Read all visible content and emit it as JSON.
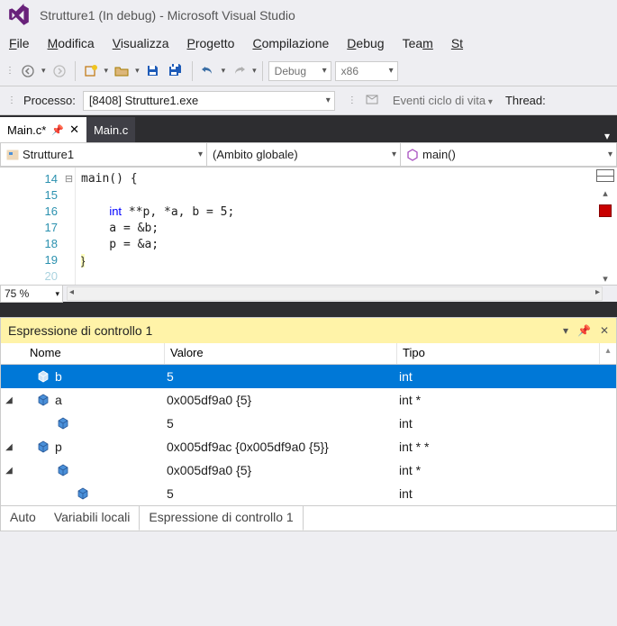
{
  "title": "Strutture1 (In debug) - Microsoft Visual Studio",
  "menu": {
    "file": "File",
    "modifica": "Modifica",
    "visualizza": "Visualizza",
    "progetto": "Progetto",
    "compilazione": "Compilazione",
    "debug": "Debug",
    "team": "Team",
    "strumenti": "St"
  },
  "toolbar": {
    "config": "Debug",
    "platform": "x86"
  },
  "process": {
    "label": "Processo:",
    "value": "[8408] Strutture1.exe",
    "lifecycle": "Eventi ciclo di vita",
    "thread": "Thread:"
  },
  "tabs": {
    "active": "Main.c*",
    "inactive": "Main.c"
  },
  "nav": {
    "project": "Strutture1",
    "scope": "(Ambito globale)",
    "func": "main()"
  },
  "editor": {
    "lines": [
      "14",
      "15",
      "16",
      "17",
      "18",
      "19",
      "20"
    ],
    "code_lines": [
      {
        "text": "main() {",
        "indent": 0
      },
      {
        "text": "",
        "indent": 0
      },
      {
        "text": "int **p, *a, b = 5;",
        "indent": 1,
        "kw": "int"
      },
      {
        "text": "a = &b;",
        "indent": 1
      },
      {
        "text": "p = &a;",
        "indent": 1
      },
      {
        "text": "}",
        "indent": 0
      },
      {
        "text": "",
        "indent": 0
      }
    ],
    "zoom": "75 %"
  },
  "watch": {
    "title": "Espressione di controllo 1",
    "headers": {
      "name": "Nome",
      "value": "Valore",
      "type": "Tipo"
    },
    "rows": [
      {
        "expander": "",
        "indent": 0,
        "selected": true,
        "name": "b",
        "value": "5",
        "type": "int"
      },
      {
        "expander": "◢",
        "indent": 0,
        "selected": false,
        "name": "a",
        "value": "0x005df9a0 {5}",
        "type": "int *"
      },
      {
        "expander": "",
        "indent": 1,
        "selected": false,
        "name": "",
        "value": "5",
        "type": "int"
      },
      {
        "expander": "◢",
        "indent": 0,
        "selected": false,
        "name": "p",
        "value": "0x005df9ac {0x005df9a0 {5}}",
        "type": "int * *"
      },
      {
        "expander": "◢",
        "indent": 1,
        "selected": false,
        "name": "",
        "value": "0x005df9a0 {5}",
        "type": "int *"
      },
      {
        "expander": "",
        "indent": 2,
        "selected": false,
        "name": "",
        "value": "5",
        "type": "int"
      }
    ],
    "tabs": {
      "auto": "Auto",
      "locals": "Variabili locali",
      "watch1": "Espressione di controllo 1"
    }
  }
}
